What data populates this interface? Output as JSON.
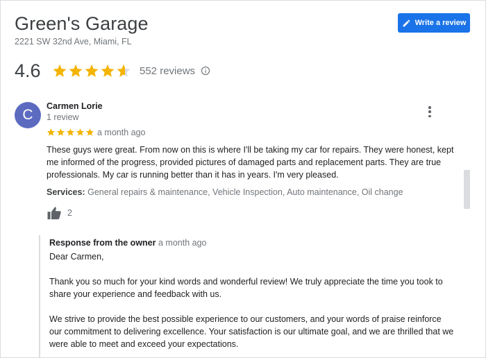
{
  "business": {
    "name": "Green's Garage",
    "address": "2221 SW 32nd Ave, Miami, FL",
    "rating": "4.6",
    "rating_value": 4.6,
    "review_count": "552 reviews"
  },
  "write_review": {
    "label": "Write a review",
    "icon": "pencil-icon"
  },
  "colors": {
    "accent": "#1a73e8",
    "star": "#f4b400",
    "avatar": "#5c6bc0"
  },
  "review": {
    "avatar_letter": "C",
    "reviewer": "Carmen Lorie",
    "reviewer_reviews": "1 review",
    "stars": 5,
    "time": "a month ago",
    "text": "These guys were great. From now on this is where I'll be taking my car for repairs.  They were honest, kept me informed of the progress, provided pictures of damaged parts and replacement parts. They are true professionals. My car is running better than it has in years. I'm very pleased.",
    "services_label": "Services:",
    "services": "General repairs & maintenance, Vehicle Inspection, Auto maintenance, Oil change",
    "likes": "2"
  },
  "owner_response": {
    "title": "Response from the owner",
    "time": "a month ago",
    "greeting": "Dear Carmen,",
    "paragraph1": "Thank you so much for your kind words and wonderful review! We truly appreciate the time you took to share your experience and feedback with us.",
    "paragraph2": "We strive to provide the best possible experience to our customers, and your words of praise reinforce our commitment to delivering excellence. Your satisfaction is our ultimate goal, and we are thrilled that we were able to meet and exceed your expectations."
  }
}
